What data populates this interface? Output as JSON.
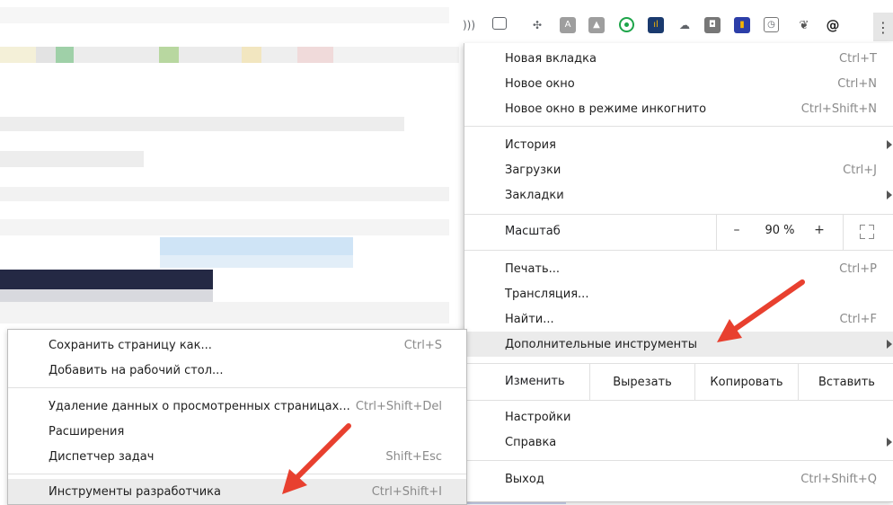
{
  "menu": {
    "items_group1": [
      {
        "label": "Новая вкладка",
        "shortcut": "Ctrl+T"
      },
      {
        "label": "Новое окно",
        "shortcut": "Ctrl+N"
      },
      {
        "label": "Новое окно в режиме инкогнито",
        "shortcut": "Ctrl+Shift+N"
      }
    ],
    "items_group2": [
      {
        "label": "История",
        "shortcut": ""
      },
      {
        "label": "Загрузки",
        "shortcut": "Ctrl+J"
      },
      {
        "label": "Закладки",
        "shortcut": ""
      }
    ],
    "zoom": {
      "label": "Масштаб",
      "minus": "–",
      "value": "90 %",
      "plus": "+"
    },
    "items_group3": [
      {
        "label": "Печать...",
        "shortcut": "Ctrl+P"
      },
      {
        "label": "Трансляция...",
        "shortcut": ""
      },
      {
        "label": "Найти...",
        "shortcut": "Ctrl+F"
      },
      {
        "label": "Дополнительные инструменты",
        "shortcut": ""
      }
    ],
    "edit": {
      "label": "Изменить",
      "cut": "Вырезать",
      "copy": "Копировать",
      "paste": "Вставить"
    },
    "items_group4": [
      {
        "label": "Настройки",
        "shortcut": ""
      },
      {
        "label": "Справка",
        "shortcut": ""
      }
    ],
    "exit": {
      "label": "Выход",
      "shortcut": "Ctrl+Shift+Q"
    }
  },
  "submenu": {
    "items": [
      {
        "label": "Сохранить страницу как...",
        "shortcut": "Ctrl+S"
      },
      {
        "label": "Добавить на рабочий стол...",
        "shortcut": ""
      },
      {
        "label": "Удаление данных о просмотренных страницах...",
        "shortcut": "Ctrl+Shift+Del"
      },
      {
        "label": "Расширения",
        "shortcut": ""
      },
      {
        "label": "Диспетчер задач",
        "shortcut": "Shift+Esc"
      },
      {
        "label": "Инструменты разработчика",
        "shortcut": "Ctrl+Shift+I"
      }
    ]
  },
  "colors": {
    "highlight": "#ebebeb",
    "arrow": "#e8402f",
    "separator": "#e0e0e0"
  },
  "toolbar_icons": [
    "audio-icon",
    "cast-icon",
    "target-icon",
    "pdf-icon",
    "picture-icon",
    "green-circle-icon",
    "chart-extension-icon",
    "cloud-icon",
    "shield-extension-icon",
    "blue-extension-icon",
    "clock-icon",
    "evernote-icon",
    "spiral-icon",
    "more-menu-icon"
  ]
}
